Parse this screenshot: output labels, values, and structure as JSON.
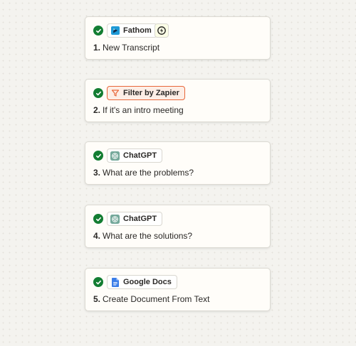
{
  "colors": {
    "background": "#f4f3ef",
    "card": "#fffdf9",
    "success_green": "#137d32",
    "filter_orange": "#e8673a",
    "filter_bg": "#fdeee6",
    "fathom_blue": "#1e9ad6",
    "chatgpt_teal": "#74a89a",
    "docs_blue": "#3b7de8"
  },
  "steps": [
    {
      "status_icon": "check-circle-icon",
      "app": {
        "name": "Fathom",
        "icon": "fathom-logo-icon"
      },
      "trigger_icon": "lightning-bolt-icon",
      "number": "1.",
      "title": "New Transcript"
    },
    {
      "status_icon": "check-circle-icon",
      "app": {
        "name": "Filter by Zapier",
        "icon": "filter-funnel-icon"
      },
      "number": "2.",
      "title": "If it's an intro meeting"
    },
    {
      "status_icon": "check-circle-icon",
      "app": {
        "name": "ChatGPT",
        "icon": "chatgpt-logo-icon"
      },
      "number": "3.",
      "title": "What are the problems?"
    },
    {
      "status_icon": "check-circle-icon",
      "app": {
        "name": "ChatGPT",
        "icon": "chatgpt-logo-icon"
      },
      "number": "4.",
      "title": "What are the solutions?"
    },
    {
      "status_icon": "check-circle-icon",
      "app": {
        "name": "Google Docs",
        "icon": "google-docs-icon"
      },
      "number": "5.",
      "title": "Create Document From Text"
    }
  ]
}
